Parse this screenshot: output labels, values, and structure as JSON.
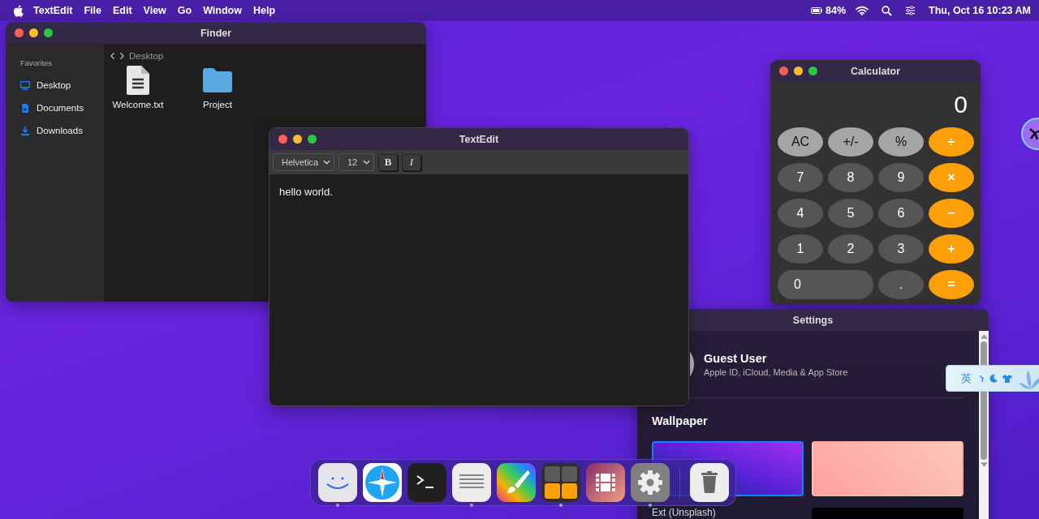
{
  "menu_bar": {
    "app": "TextEdit",
    "items": [
      "File",
      "Edit",
      "View",
      "Go",
      "Window",
      "Help"
    ],
    "battery": "84%",
    "datetime": "Thu, Oct 16 10:23 AM"
  },
  "finder": {
    "title": "Finder",
    "sidebar_heading": "Favorites",
    "sidebar_items": [
      {
        "label": "Desktop",
        "kind": "desktop"
      },
      {
        "label": "Documents",
        "kind": "document"
      },
      {
        "label": "Downloads",
        "kind": "download"
      }
    ],
    "path": "Desktop",
    "files": [
      {
        "name": "Welcome.txt",
        "kind": "text"
      },
      {
        "name": "Project",
        "kind": "folder"
      }
    ]
  },
  "textedit": {
    "title": "TextEdit",
    "font": "Helvetica",
    "size": "12",
    "bold": "B",
    "italic": "I",
    "body": "hello world."
  },
  "calculator": {
    "title": "Calculator",
    "display": "0",
    "keys": [
      {
        "label": "AC",
        "kind": "function"
      },
      {
        "label": "+/-",
        "kind": "function"
      },
      {
        "label": "%",
        "kind": "function"
      },
      {
        "label": "÷",
        "kind": "operator"
      },
      {
        "label": "7",
        "kind": "digit"
      },
      {
        "label": "8",
        "kind": "digit"
      },
      {
        "label": "9",
        "kind": "digit"
      },
      {
        "label": "×",
        "kind": "operator"
      },
      {
        "label": "4",
        "kind": "digit"
      },
      {
        "label": "5",
        "kind": "digit"
      },
      {
        "label": "6",
        "kind": "digit"
      },
      {
        "label": "−",
        "kind": "operator"
      },
      {
        "label": "1",
        "kind": "digit"
      },
      {
        "label": "2",
        "kind": "digit"
      },
      {
        "label": "3",
        "kind": "digit"
      },
      {
        "label": "+",
        "kind": "operator"
      },
      {
        "label": "0",
        "kind": "wide"
      },
      {
        "label": ".",
        "kind": "digit"
      },
      {
        "label": "=",
        "kind": "operator"
      }
    ]
  },
  "settings": {
    "title": "Settings",
    "user_name": "Guest User",
    "user_subtitle": "Apple ID, iCloud, Media & App Store",
    "section": "Wallpaper",
    "wallpapers": [
      {
        "kind": "violet",
        "selected": true
      },
      {
        "kind": "rose",
        "selected": false
      },
      {
        "kind": "black",
        "selected": false
      }
    ],
    "wallpaper_label": "Ext (Unsplash)"
  },
  "input_method": {
    "label": "英"
  },
  "dock": [
    {
      "kind": "finder",
      "running": true
    },
    {
      "kind": "safari",
      "running": false
    },
    {
      "kind": "terminal",
      "running": false
    },
    {
      "kind": "textedit",
      "running": true
    },
    {
      "kind": "paint",
      "running": false
    },
    {
      "kind": "calculator",
      "running": true
    },
    {
      "kind": "video",
      "running": false
    },
    {
      "kind": "settings",
      "running": true
    },
    {
      "kind": "trash",
      "running": false
    }
  ]
}
